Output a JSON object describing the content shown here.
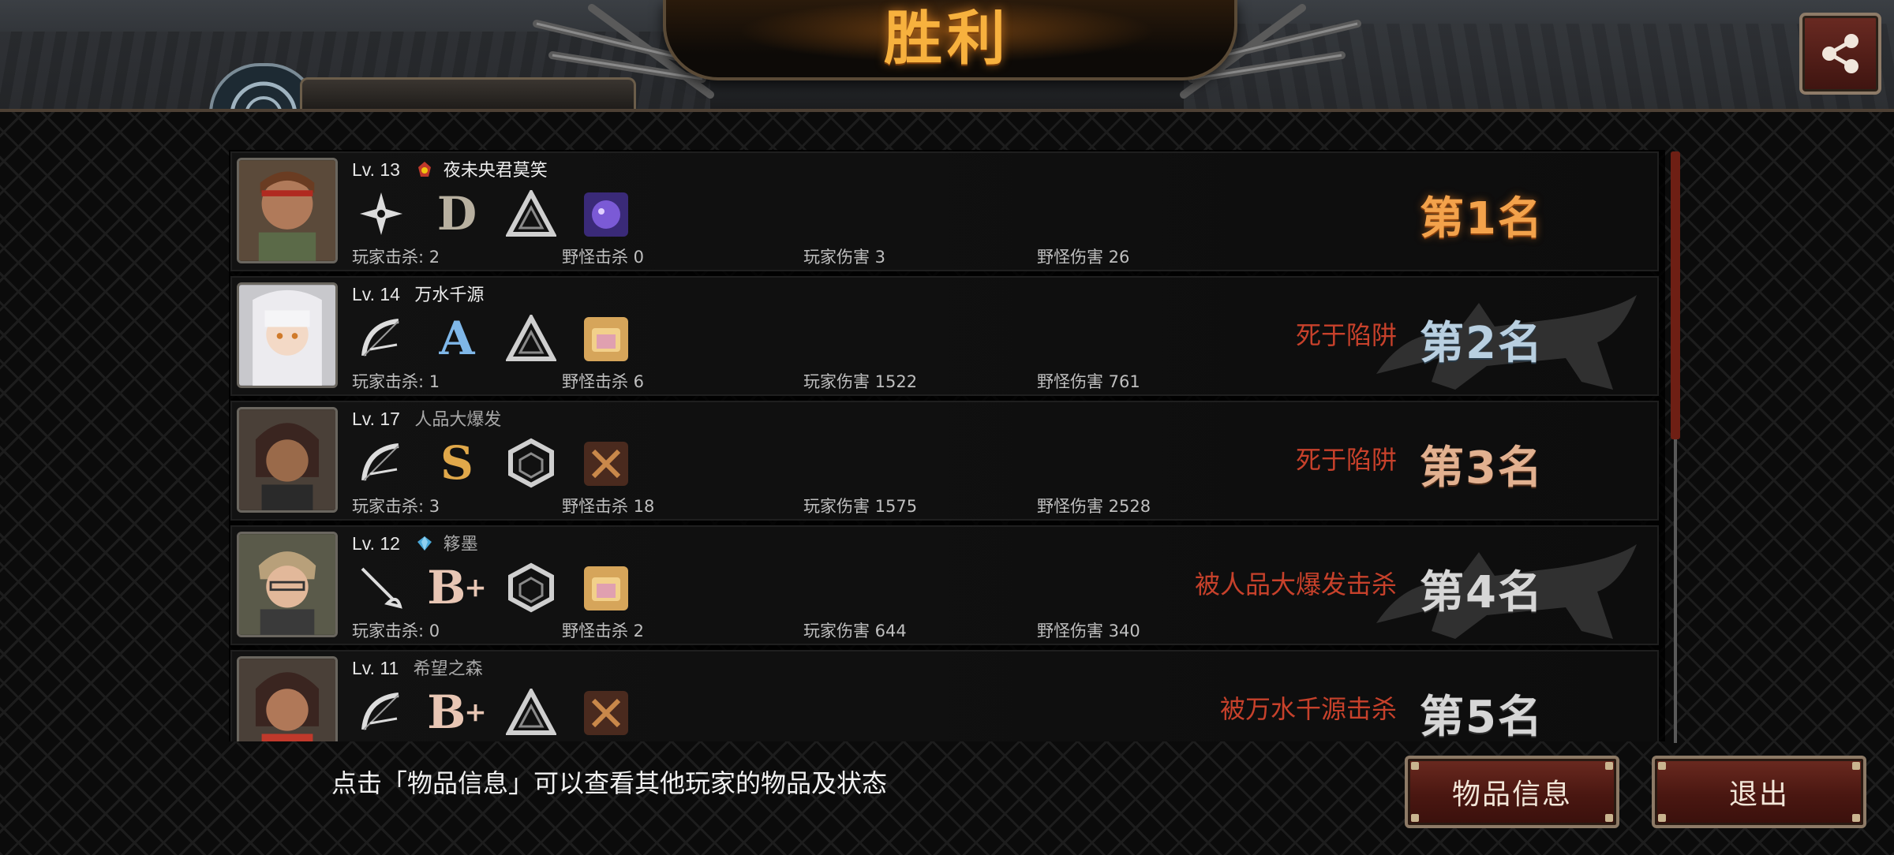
{
  "header": {
    "title": "胜利",
    "badge_text": ""
  },
  "players": [
    {
      "lv_label": "Lv. 13",
      "rank_icon": "flame-badge-icon",
      "name": "夜未央君莫笑",
      "weapon_icon": "shuriken-icon",
      "grade": "D",
      "armor_icon": "triangle-armor-icon",
      "item_icon": "purple-creature-icon",
      "player_kills": "玩家击杀: 2",
      "monster_kills": "野怪击杀 0",
      "player_damage": "玩家伤害 3",
      "monster_damage": "野怪伤害 26",
      "death": "",
      "rank": "第1名"
    },
    {
      "lv_label": "Lv. 14",
      "rank_icon": "",
      "name": "万水千源",
      "weapon_icon": "bow-icon",
      "grade": "A",
      "armor_icon": "triangle-armor-icon",
      "item_icon": "gold-box-icon",
      "player_kills": "玩家击杀: 1",
      "monster_kills": "野怪击杀 6",
      "player_damage": "玩家伤害 1522",
      "monster_damage": "野怪伤害 761",
      "death": "死于陷阱",
      "rank": "第2名"
    },
    {
      "lv_label": "Lv. 17",
      "rank_icon": "",
      "name": "人品大爆发",
      "weapon_icon": "bow-icon",
      "grade": "S",
      "armor_icon": "hex-armor-icon",
      "item_icon": "crossed-item-icon",
      "player_kills": "玩家击杀: 3",
      "monster_kills": "野怪击杀 18",
      "player_damage": "玩家伤害 1575",
      "monster_damage": "野怪伤害 2528",
      "death": "死于陷阱",
      "rank": "第3名"
    },
    {
      "lv_label": "Lv. 12",
      "rank_icon": "blue-gem-icon",
      "name": "簃墨",
      "weapon_icon": "rapier-icon",
      "grade": "B",
      "armor_icon": "hex-armor-icon",
      "item_icon": "gold-box-icon",
      "player_kills": "玩家击杀: 0",
      "monster_kills": "野怪击杀 2",
      "player_damage": "玩家伤害 644",
      "monster_damage": "野怪伤害 340",
      "death": "被人品大爆发击杀",
      "rank": "第4名"
    },
    {
      "lv_label": "Lv. 11",
      "rank_icon": "",
      "name": "希望之森",
      "weapon_icon": "bow-icon",
      "grade": "B",
      "armor_icon": "triangle-armor-icon",
      "item_icon": "crossed-item-icon",
      "player_kills": "",
      "monster_kills": "",
      "player_damage": "",
      "monster_damage": "",
      "death": "被万水千源击杀",
      "rank": "第5名"
    }
  ],
  "footer": {
    "hint": "点击「物品信息」可以查看其他玩家的物品及状态",
    "info_button": "物品信息",
    "exit_button": "退出"
  },
  "colors": {
    "title": "#f7b13e",
    "death_text": "#c7412b",
    "button_bg": "#4a1711",
    "rank1": "#f3a24b"
  }
}
